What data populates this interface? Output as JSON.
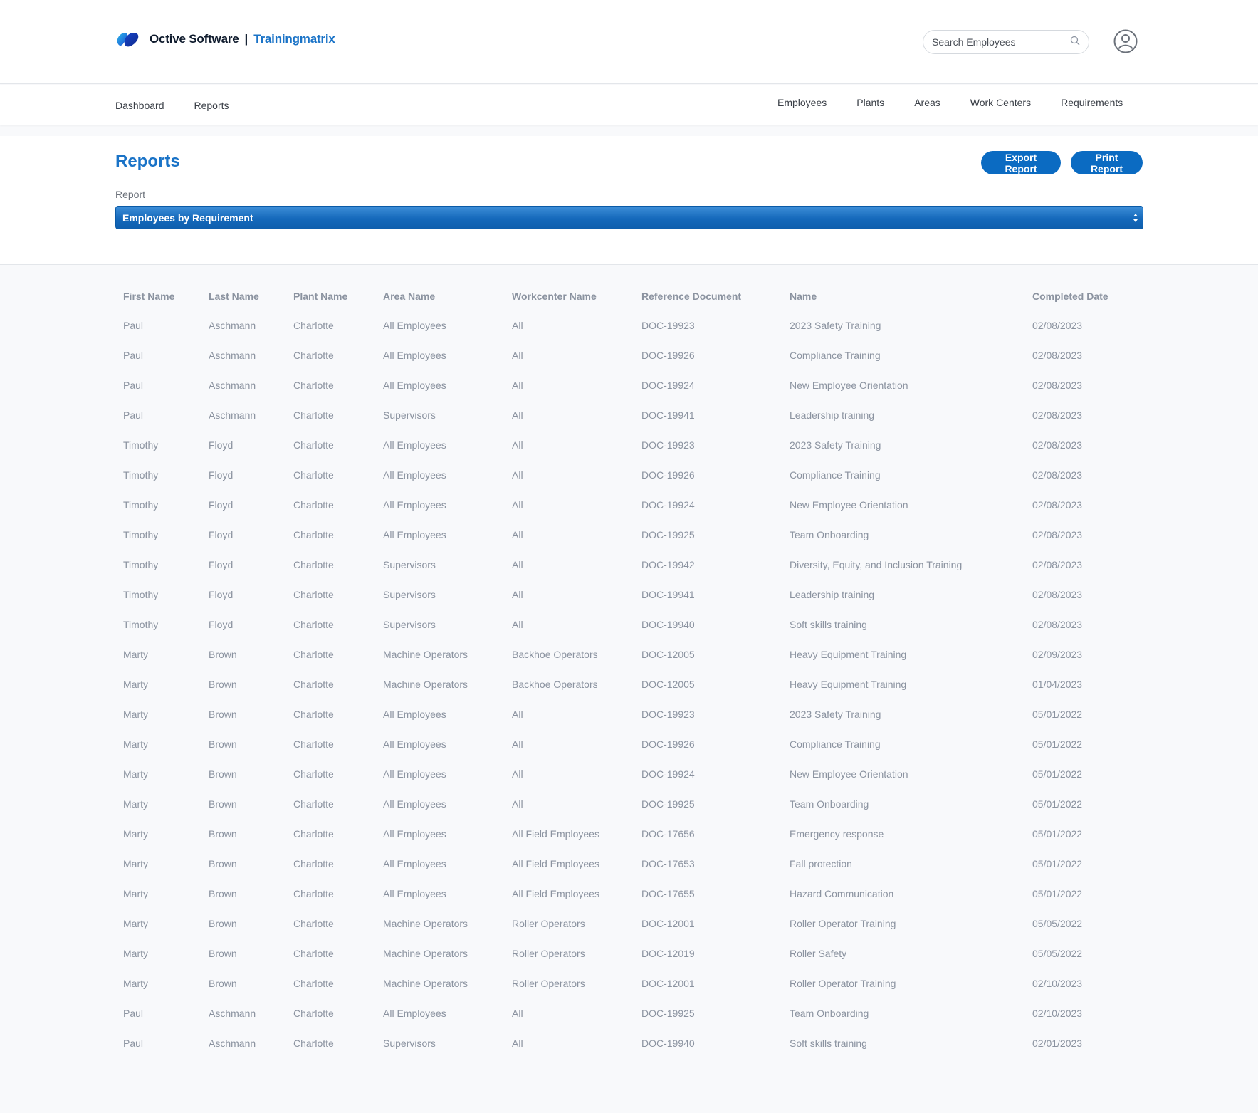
{
  "brand": {
    "company": "Octive Software",
    "separator": "|",
    "product": "Trainingmatrix"
  },
  "search": {
    "placeholder": "Search Employees"
  },
  "nav": {
    "left": [
      "Dashboard",
      "Reports"
    ],
    "right": [
      "Employees",
      "Plants",
      "Areas",
      "Work Centers",
      "Requirements"
    ]
  },
  "page": {
    "title": "Reports",
    "export_label": "Export Report",
    "print_label": "Print Report",
    "report_label": "Report",
    "report_selected": "Employees by Requirement"
  },
  "colors": {
    "accent": "#0b6bc2",
    "title": "#1a73c7",
    "muted_text": "#8b93a0"
  },
  "table": {
    "columns": [
      "First Name",
      "Last Name",
      "Plant Name",
      "Area Name",
      "Workcenter Name",
      "Reference Document",
      "Name",
      "Completed Date"
    ],
    "rows": [
      [
        "Paul",
        "Aschmann",
        "Charlotte",
        "All Employees",
        "All",
        "DOC-19923",
        "2023 Safety Training",
        "02/08/2023"
      ],
      [
        "Paul",
        "Aschmann",
        "Charlotte",
        "All Employees",
        "All",
        "DOC-19926",
        "Compliance Training",
        "02/08/2023"
      ],
      [
        "Paul",
        "Aschmann",
        "Charlotte",
        "All Employees",
        "All",
        "DOC-19924",
        "New Employee Orientation",
        "02/08/2023"
      ],
      [
        "Paul",
        "Aschmann",
        "Charlotte",
        "Supervisors",
        "All",
        "DOC-19941",
        "Leadership training",
        "02/08/2023"
      ],
      [
        "Timothy",
        "Floyd",
        "Charlotte",
        "All Employees",
        "All",
        "DOC-19923",
        "2023 Safety Training",
        "02/08/2023"
      ],
      [
        "Timothy",
        "Floyd",
        "Charlotte",
        "All Employees",
        "All",
        "DOC-19926",
        "Compliance Training",
        "02/08/2023"
      ],
      [
        "Timothy",
        "Floyd",
        "Charlotte",
        "All Employees",
        "All",
        "DOC-19924",
        "New Employee Orientation",
        "02/08/2023"
      ],
      [
        "Timothy",
        "Floyd",
        "Charlotte",
        "All Employees",
        "All",
        "DOC-19925",
        "Team Onboarding",
        "02/08/2023"
      ],
      [
        "Timothy",
        "Floyd",
        "Charlotte",
        "Supervisors",
        "All",
        "DOC-19942",
        "Diversity, Equity, and Inclusion Training",
        "02/08/2023"
      ],
      [
        "Timothy",
        "Floyd",
        "Charlotte",
        "Supervisors",
        "All",
        "DOC-19941",
        "Leadership training",
        "02/08/2023"
      ],
      [
        "Timothy",
        "Floyd",
        "Charlotte",
        "Supervisors",
        "All",
        "DOC-19940",
        "Soft skills training",
        "02/08/2023"
      ],
      [
        "Marty",
        "Brown",
        "Charlotte",
        "Machine Operators",
        "Backhoe Operators",
        "DOC-12005",
        "Heavy Equipment Training",
        "02/09/2023"
      ],
      [
        "Marty",
        "Brown",
        "Charlotte",
        "Machine Operators",
        "Backhoe Operators",
        "DOC-12005",
        "Heavy Equipment Training",
        "01/04/2023"
      ],
      [
        "Marty",
        "Brown",
        "Charlotte",
        "All Employees",
        "All",
        "DOC-19923",
        "2023 Safety Training",
        "05/01/2022"
      ],
      [
        "Marty",
        "Brown",
        "Charlotte",
        "All Employees",
        "All",
        "DOC-19926",
        "Compliance Training",
        "05/01/2022"
      ],
      [
        "Marty",
        "Brown",
        "Charlotte",
        "All Employees",
        "All",
        "DOC-19924",
        "New Employee Orientation",
        "05/01/2022"
      ],
      [
        "Marty",
        "Brown",
        "Charlotte",
        "All Employees",
        "All",
        "DOC-19925",
        "Team Onboarding",
        "05/01/2022"
      ],
      [
        "Marty",
        "Brown",
        "Charlotte",
        "All Employees",
        "All Field Employees",
        "DOC-17656",
        "Emergency response",
        "05/01/2022"
      ],
      [
        "Marty",
        "Brown",
        "Charlotte",
        "All Employees",
        "All Field Employees",
        "DOC-17653",
        "Fall protection",
        "05/01/2022"
      ],
      [
        "Marty",
        "Brown",
        "Charlotte",
        "All Employees",
        "All Field Employees",
        "DOC-17655",
        "Hazard Communication",
        "05/01/2022"
      ],
      [
        "Marty",
        "Brown",
        "Charlotte",
        "Machine Operators",
        "Roller Operators",
        "DOC-12001",
        "Roller Operator Training",
        "05/05/2022"
      ],
      [
        "Marty",
        "Brown",
        "Charlotte",
        "Machine Operators",
        "Roller Operators",
        "DOC-12019",
        "Roller Safety",
        "05/05/2022"
      ],
      [
        "Marty",
        "Brown",
        "Charlotte",
        "Machine Operators",
        "Roller Operators",
        "DOC-12001",
        "Roller Operator Training",
        "02/10/2023"
      ],
      [
        "Paul",
        "Aschmann",
        "Charlotte",
        "All Employees",
        "All",
        "DOC-19925",
        "Team Onboarding",
        "02/10/2023"
      ],
      [
        "Paul",
        "Aschmann",
        "Charlotte",
        "Supervisors",
        "All",
        "DOC-19940",
        "Soft skills training",
        "02/01/2023"
      ]
    ]
  }
}
